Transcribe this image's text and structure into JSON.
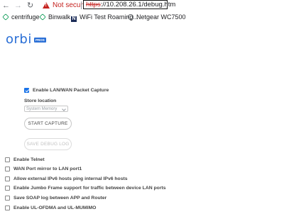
{
  "browser": {
    "security_text": "Not secure",
    "url_scheme": "https",
    "url_rest": "://10.208.26.1/debug.htm",
    "nav": {
      "back": "←",
      "forward": "→",
      "reload": "↻"
    },
    "warning_icon": "warning-triangle-icon"
  },
  "bookmarks": [
    {
      "label": "centrifuge",
      "icon": "hex-icon"
    },
    {
      "label": "Binwalk",
      "icon": "hex-icon"
    },
    {
      "label": "WiFi Test Roaming...",
      "icon": "n-icon"
    },
    {
      "label": "Netgear WC7500",
      "icon": "globe-icon"
    }
  ],
  "logo": {
    "text": "orbi",
    "badge": "PROS"
  },
  "capture": {
    "enable_label": "Enable LAN/WAN Packet Capture",
    "enable_checked": true,
    "store_location_label": "Store location",
    "store_location_value": "System Memory",
    "start_button": "START CAPTURE",
    "save_log_button": "SAVE DEBUG LOG"
  },
  "options": [
    {
      "label": "Enable Telnet",
      "checked": false
    },
    {
      "label": "WAN Port mirror to LAN port1",
      "checked": false
    },
    {
      "label": "Allow external IPv6 hosts ping internal IPv6 hosts",
      "checked": false
    },
    {
      "label": "Enable Jumbo Frame support for traffic between device LAN ports",
      "checked": false
    },
    {
      "label": "Save SOAP log between APP and Router",
      "checked": false
    },
    {
      "label": "Enable UL-OFDMA and UL-MUMIMO",
      "checked": false
    }
  ],
  "colors": {
    "accent": "#1a73e8",
    "logo": "#2a6fd6",
    "warning": "#c5221f"
  }
}
